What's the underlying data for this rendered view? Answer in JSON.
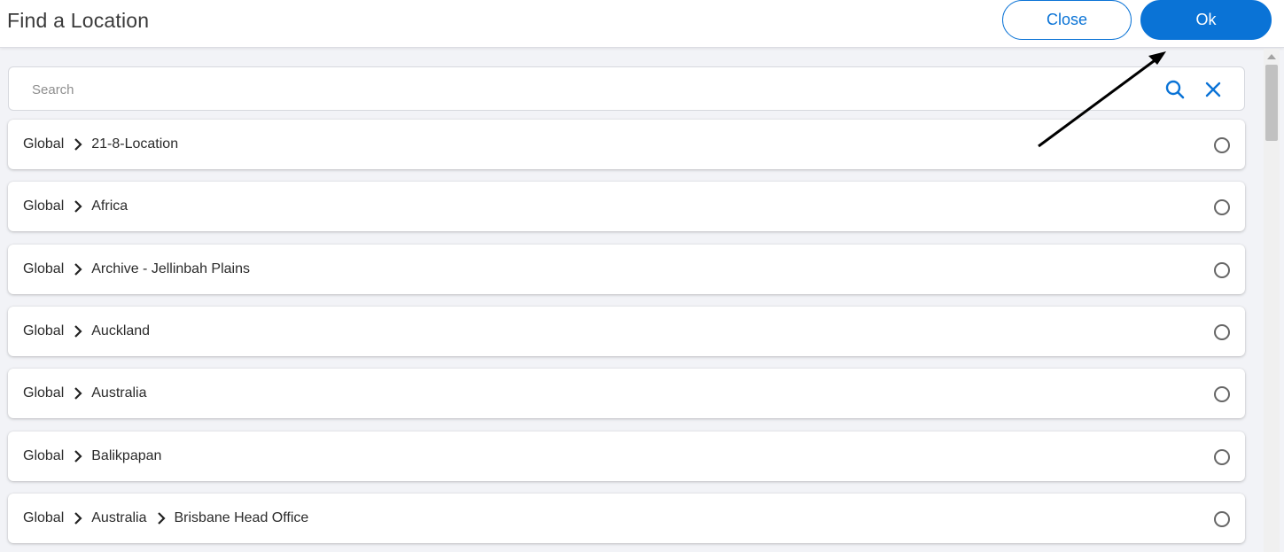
{
  "dialog": {
    "title": "Find a Location",
    "close_label": "Close",
    "ok_label": "Ok"
  },
  "search": {
    "placeholder": "Search",
    "value": ""
  },
  "locations": [
    {
      "path": [
        "Global",
        "21-8-Location"
      ],
      "selected": false
    },
    {
      "path": [
        "Global",
        "Africa"
      ],
      "selected": false
    },
    {
      "path": [
        "Global",
        "Archive - Jellinbah Plains"
      ],
      "selected": false
    },
    {
      "path": [
        "Global",
        "Auckland"
      ],
      "selected": false
    },
    {
      "path": [
        "Global",
        "Australia"
      ],
      "selected": false
    },
    {
      "path": [
        "Global",
        "Balikpapan"
      ],
      "selected": false
    },
    {
      "path": [
        "Global",
        "Australia",
        "Brisbane Head Office"
      ],
      "selected": false
    }
  ],
  "colors": {
    "accent": "#0a73d6",
    "background": "#f2f3f7"
  },
  "icons": {
    "search": "search-icon",
    "clear": "close-icon",
    "separator": "chevron-right-icon",
    "radio": "radio-unchecked-icon"
  }
}
